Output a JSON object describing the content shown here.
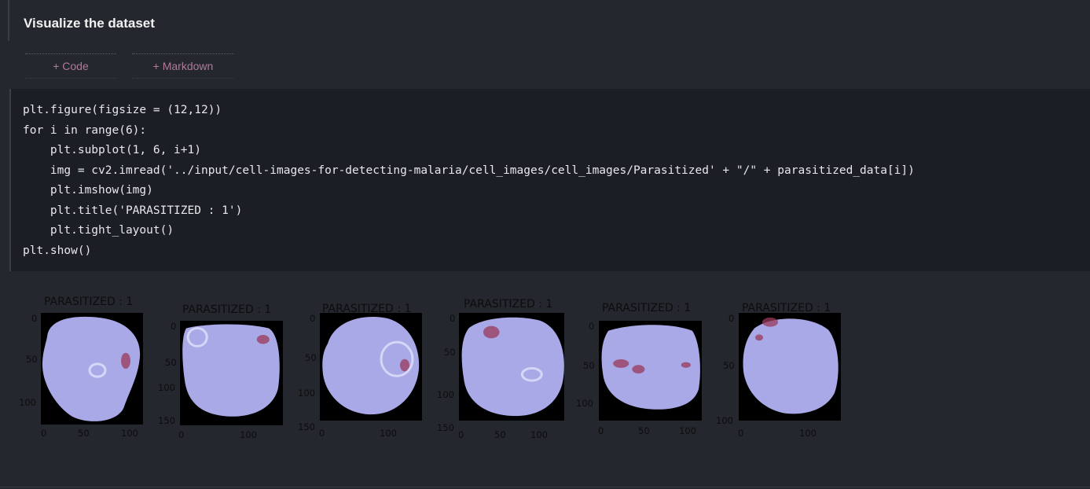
{
  "markdown_cell": {
    "title": "Visualize the dataset"
  },
  "add_buttons": {
    "code_label": "+ Code",
    "markdown_label": "+ Markdown"
  },
  "code_lines": [
    "plt.figure(figsize = (12,12))",
    "for i in range(6):",
    "    plt.subplot(1, 6, i+1)",
    "    img = cv2.imread('../input/cell-images-for-detecting-malaria/cell_images/cell_images/Parasitized' + \"/\" + parasitized_data[i])",
    "    plt.imshow(img)",
    "    plt.title('PARASITIZED : 1')",
    "    plt.tight_layout()",
    "plt.show()"
  ],
  "output": {
    "panels": [
      {
        "title": "PARASITIZED : 1",
        "y_ticks": [
          "0",
          "50",
          "100"
        ],
        "x_ticks": [
          "0",
          "50",
          "100"
        ]
      },
      {
        "title": "PARASITIZED : 1",
        "y_ticks": [
          "0",
          "50",
          "100",
          "150"
        ],
        "x_ticks": [
          "0",
          "100"
        ]
      },
      {
        "title": "PARASITIZED : 1",
        "y_ticks": [
          "0",
          "50",
          "100",
          "150"
        ],
        "x_ticks": [
          "0",
          "100"
        ]
      },
      {
        "title": "PARASITIZED : 1",
        "y_ticks": [
          "0",
          "50",
          "100",
          "150"
        ],
        "x_ticks": [
          "0",
          "50",
          "100"
        ]
      },
      {
        "title": "PARASITIZED : 1",
        "y_ticks": [
          "0",
          "50",
          "100"
        ],
        "x_ticks": [
          "0",
          "50",
          "100"
        ]
      },
      {
        "title": "PARASITIZED : 1",
        "y_ticks": [
          "0",
          "50",
          "100"
        ],
        "x_ticks": [
          "0",
          "100"
        ]
      }
    ]
  },
  "colors": {
    "cell_fill": "#a9a9e8",
    "stain": "#9a3a5a",
    "background": "#24272e"
  }
}
